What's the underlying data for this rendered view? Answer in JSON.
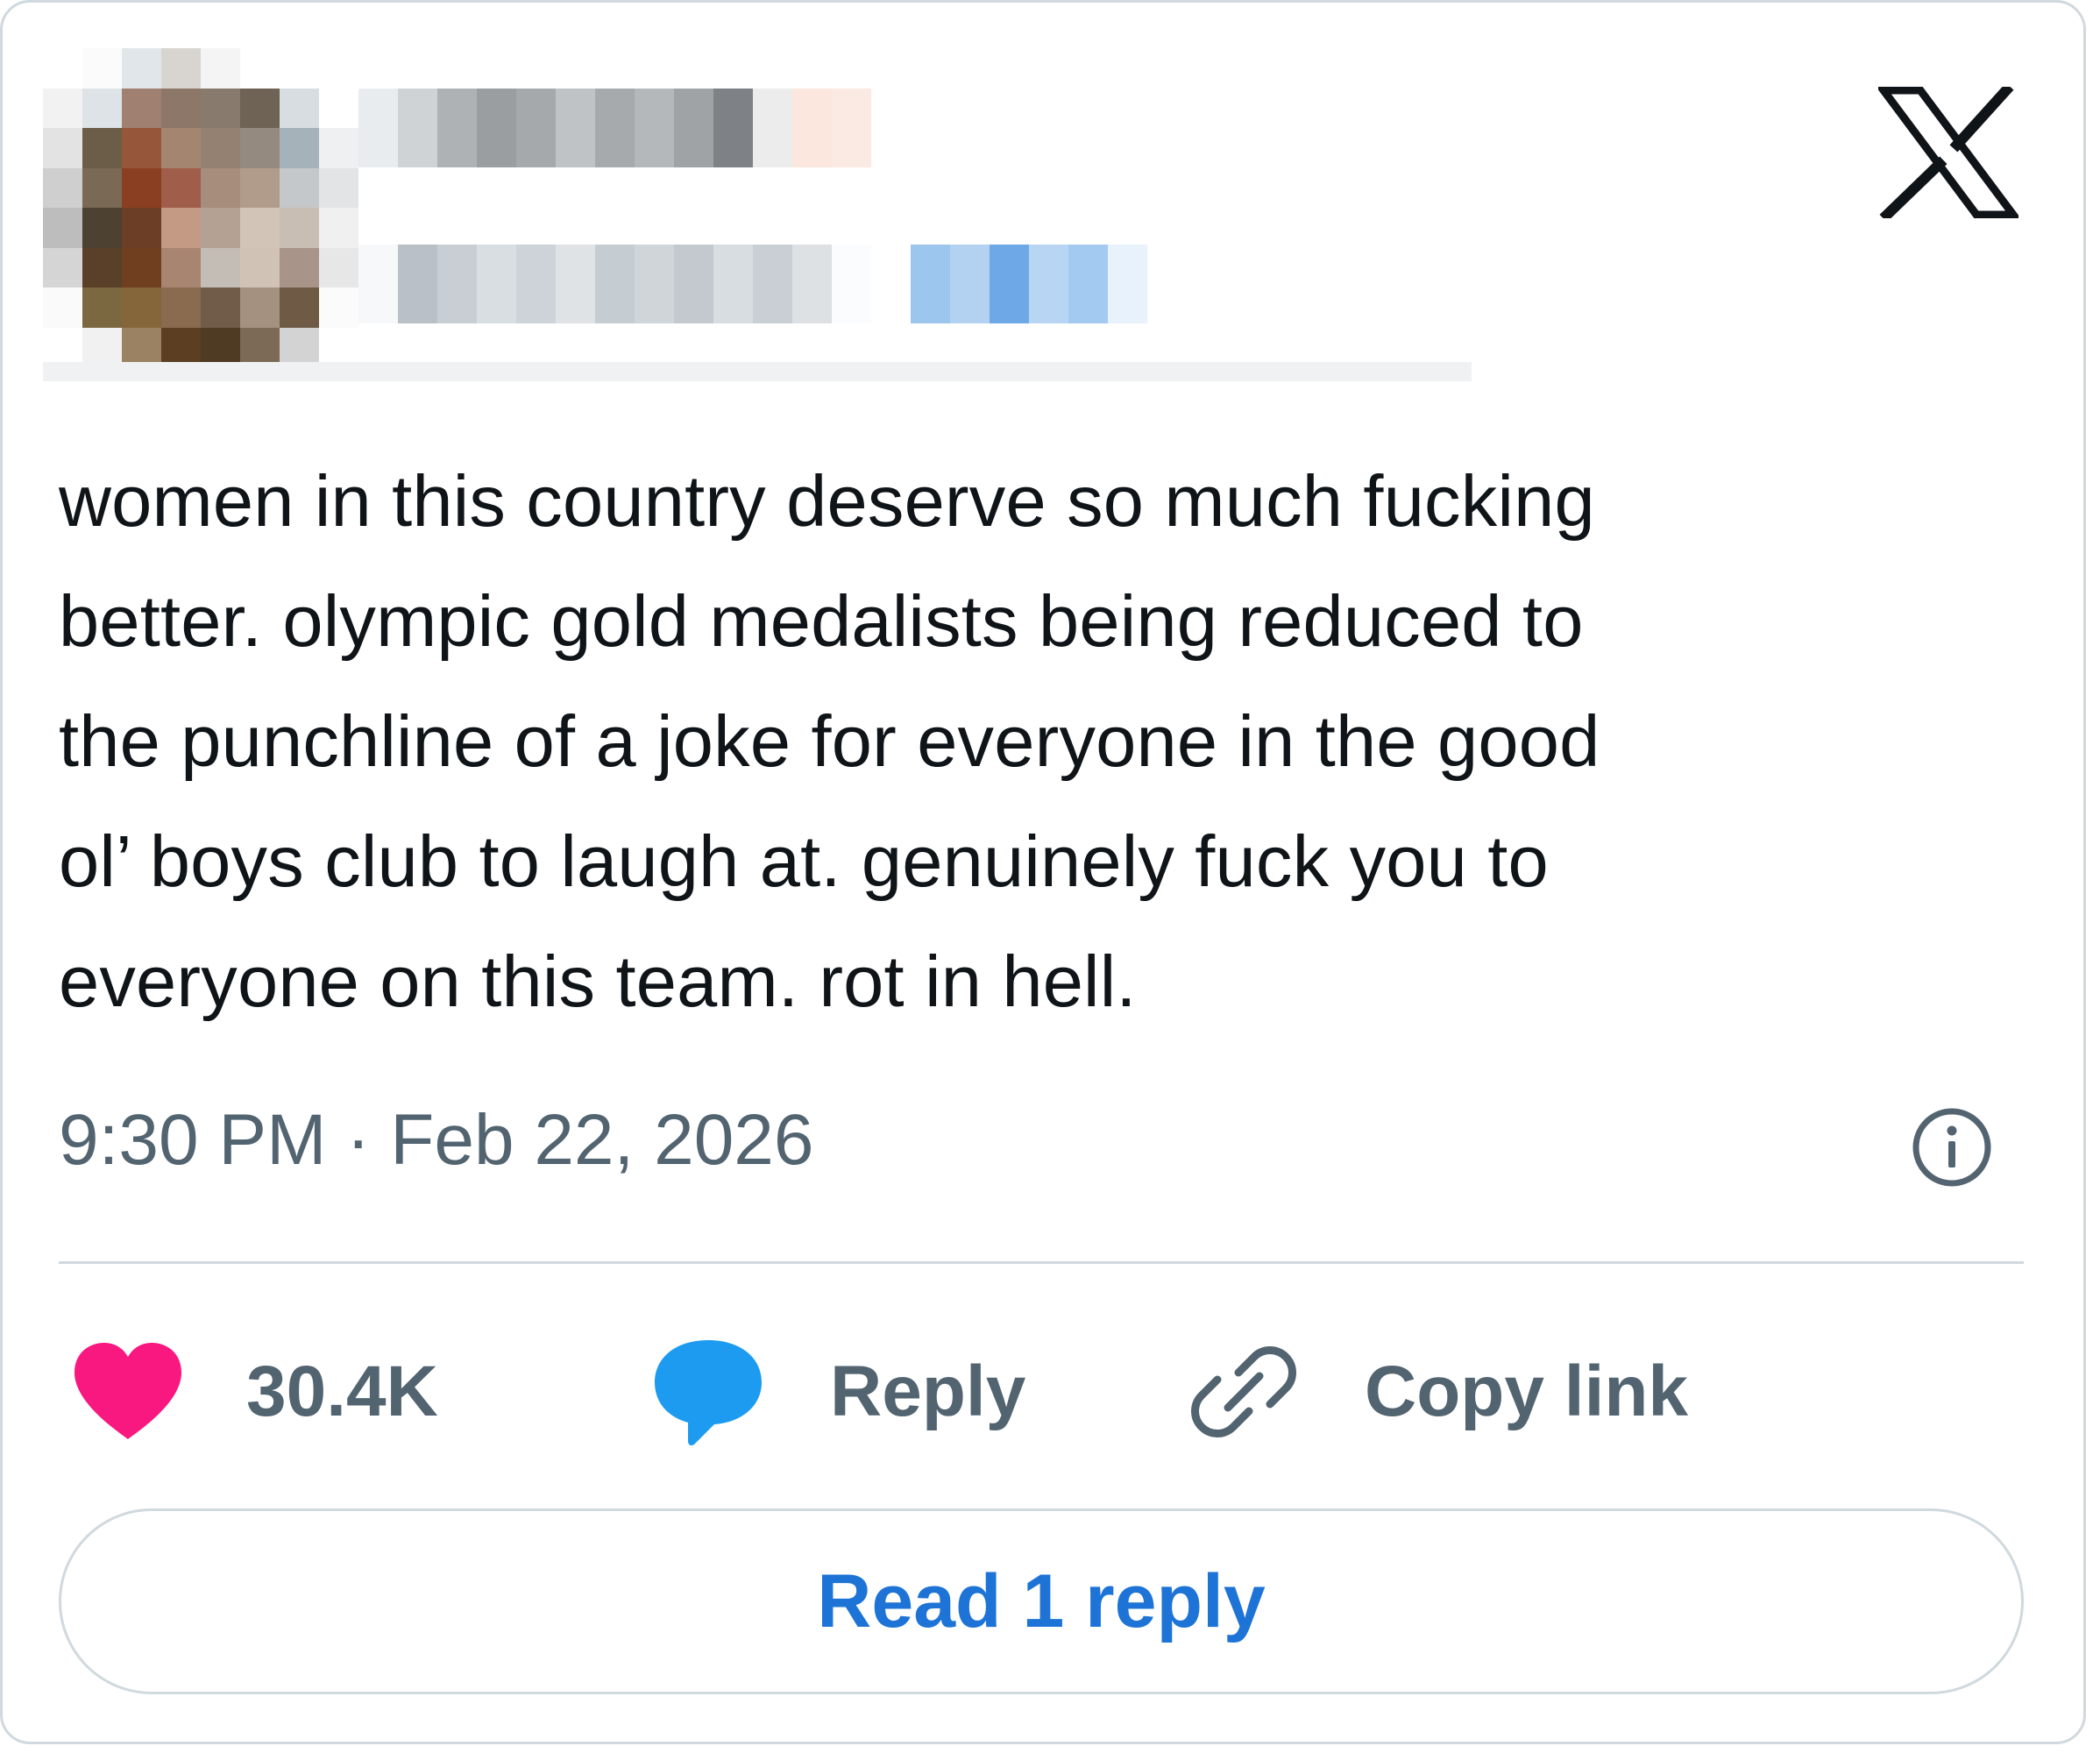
{
  "tweet": {
    "text_lines": [
      "women in this country deserve so much fucking",
      "better. olympic gold medalists being reduced to",
      "the punchline of a joke for everyone in the good",
      "ol’ boys club to laugh at. genuinely fuck you to",
      "everyone on this team. rot in hell."
    ],
    "timestamp": "9:30 PM · Feb 22, 2026"
  },
  "actions": {
    "like_count": "30.4K",
    "reply_label": "Reply",
    "copy_link_label": "Copy link"
  },
  "read_replies_label": "Read 1 reply",
  "icons": {
    "brand": "x-logo-icon",
    "info": "info-icon",
    "like": "heart-icon",
    "reply": "speech-bubble-icon",
    "copy": "link-icon"
  },
  "colors": {
    "heart": "#f91880",
    "reply_bubble": "#1d9bf0",
    "link_blue": "#1d74d6",
    "secondary_text": "#536471",
    "border": "#cfd9de"
  }
}
